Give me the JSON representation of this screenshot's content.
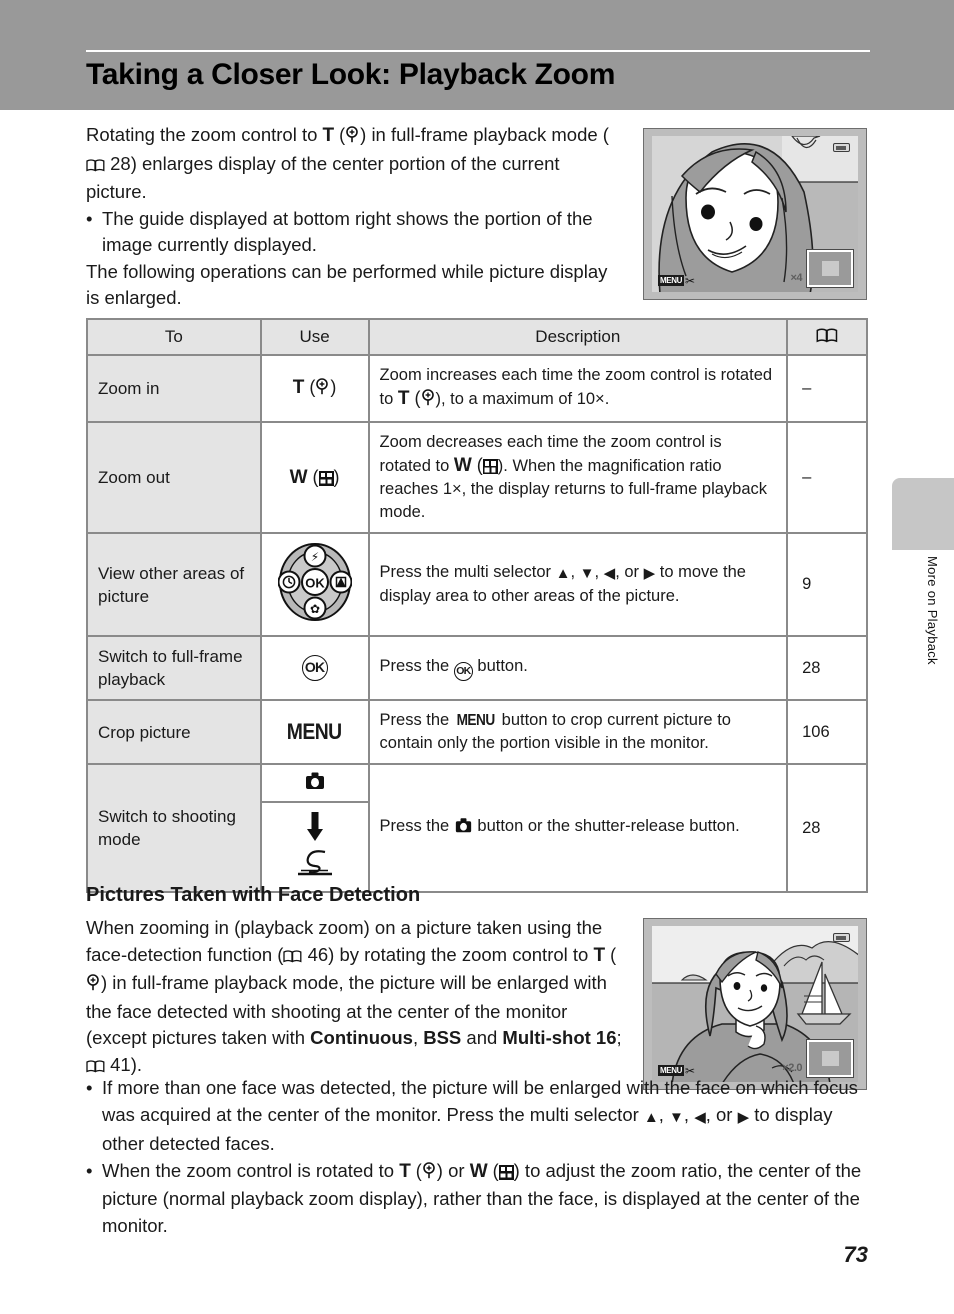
{
  "header": {
    "title": "Taking a Closer Look: Playback Zoom"
  },
  "side_tab": {
    "label": "More on Playback"
  },
  "intro": {
    "p1_a": "Rotating the zoom control to ",
    "p1_T": "T",
    "p1_b": ") in full-frame playback mode (",
    "p1_ref": "28",
    "p1_c": ") enlarges display of the center portion of the current picture.",
    "bullet_dot": "•",
    "bullet1": "The guide displayed at bottom right shows the portion of the image currently displayed.",
    "p2": "The following operations can be performed while picture display is enlarged."
  },
  "lcd_top": {
    "menu_label": "MENU",
    "scissors_icon": "scissors-icon",
    "zoom_ratio": "×4",
    "guide_icon": "zoom-guide-icon",
    "battery_icon": "battery-icon"
  },
  "lcd_bottom": {
    "menu_label": "MENU",
    "scissors_icon": "scissors-icon",
    "zoom_ratio": "×2.0",
    "guide_icon": "zoom-guide-icon",
    "battery_icon": "battery-icon"
  },
  "table": {
    "headers": {
      "to": "To",
      "use": "Use",
      "description": "Description",
      "reference": "book-icon"
    },
    "rows": [
      {
        "to": "Zoom in",
        "use_label": "T",
        "use_icon": "magnifier-plus-icon",
        "desc_a": "Zoom increases each time the zoom control is rotated to ",
        "desc_T": "T",
        "desc_b": "), to a maximum of 10×.",
        "ref": "–"
      },
      {
        "to": "Zoom out",
        "use_label": "W",
        "use_icon": "thumbnail-grid-icon",
        "desc_a": "Zoom decreases each time the zoom control is rotated to ",
        "desc_W": "W",
        "desc_b": "). When the magnification ratio reaches 1×, the display returns to full-frame playback mode.",
        "ref": "–"
      },
      {
        "to": "View other areas of picture",
        "use_icon": "multi-selector-icon",
        "desc_a": "Press the multi selector ",
        "desc_up": "▲",
        "desc_down": "▼",
        "desc_left": "◀",
        "desc_right": "▶",
        "desc_or": ", or ",
        "desc_b": " to move the display area to other areas of the picture.",
        "ref": "9"
      },
      {
        "to": "Switch to full-frame playback",
        "use_icon": "ok-button-icon",
        "use_label": "OK",
        "desc_a": "Press the ",
        "desc_b": " button.",
        "ref": "28"
      },
      {
        "to": "Crop picture",
        "use_label": "MENU",
        "use_icon": "menu-button-icon",
        "desc_a": "Press the ",
        "desc_menu": "MENU",
        "desc_b": " button to crop current picture to contain only the portion visible in the monitor.",
        "ref": "106"
      },
      {
        "to": "Switch to shooting mode",
        "use_icon_top": "camera-playback-button-icon",
        "use_icon_arrow": "down-arrow-icon",
        "use_icon_bottom": "shutter-release-icon",
        "desc_a": "Press the ",
        "desc_b": " button or the shutter-release button.",
        "ref": "28"
      }
    ]
  },
  "section2": {
    "title": "Pictures Taken with Face Detection",
    "body_a": "When zooming in (playback zoom) on a picture taken using the face-detection function (",
    "body_ref1": "46",
    "body_b": ") by rotating the zoom control to ",
    "body_T": "T",
    "body_c": ") in full-frame playback mode, the picture will be enlarged with the face detected with shooting at the center of the monitor (except pictures taken with ",
    "body_bold1": "Continuous",
    "body_comma": ", ",
    "body_bold2": "BSS",
    "body_and": " and ",
    "body_bold3": "Multi-shot 16",
    "body_semi": "; ",
    "body_ref2": "41",
    "body_end": ").",
    "bullet_dot": "•",
    "bullet1_a": "If more than one face was detected, the picture will be enlarged with the face on which focus was acquired at the center of the monitor. Press the multi selector ",
    "bullet1_up": "▲",
    "bullet1_down": "▼",
    "bullet1_left": "◀",
    "bullet1_right": "▶",
    "bullet1_or": ", or ",
    "bullet1_b": " to display other detected faces.",
    "bullet2_a": "When the zoom control is rotated to ",
    "bullet2_T": "T",
    "bullet2_mid": ") or ",
    "bullet2_W": "W",
    "bullet2_b": ") to adjust the zoom ratio, the center of the picture (normal playback zoom display), rather than the face, is displayed at the center of the monitor."
  },
  "page_number": "73",
  "colors": {
    "header_band": "#999999",
    "table_header_bg": "#e4e4e4",
    "table_border": "#8a8a8a",
    "side_tab": "#c6c6c6"
  }
}
